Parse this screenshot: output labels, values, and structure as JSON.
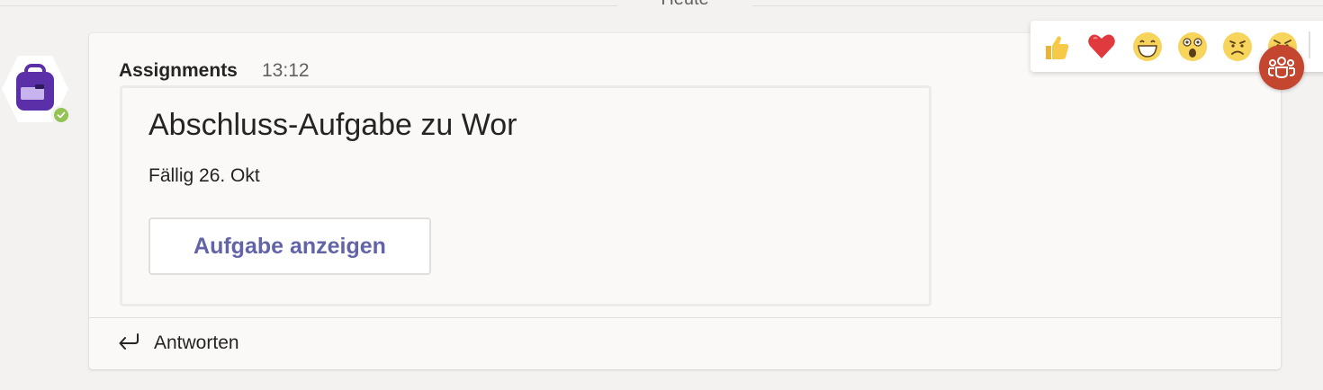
{
  "date_divider": {
    "label": "Heute"
  },
  "message": {
    "sender": "Assignments",
    "time": "13:12",
    "avatar_icon": "assignments-backpack-icon",
    "status": "available",
    "card": {
      "title": "Abschluss-Aufgabe zu Wor",
      "due": "Fällig 26. Okt",
      "button_label": "Aufgabe anzeigen"
    },
    "reply_label": "Antworten"
  },
  "reactions": [
    "like-icon",
    "heart-icon",
    "laugh-icon",
    "surprised-icon",
    "sad-icon",
    "angry-icon"
  ],
  "colors": {
    "accent": "#6264a7",
    "avatar": "#5b2fa8",
    "status_green": "#92c353",
    "participants": "#c4462f"
  }
}
